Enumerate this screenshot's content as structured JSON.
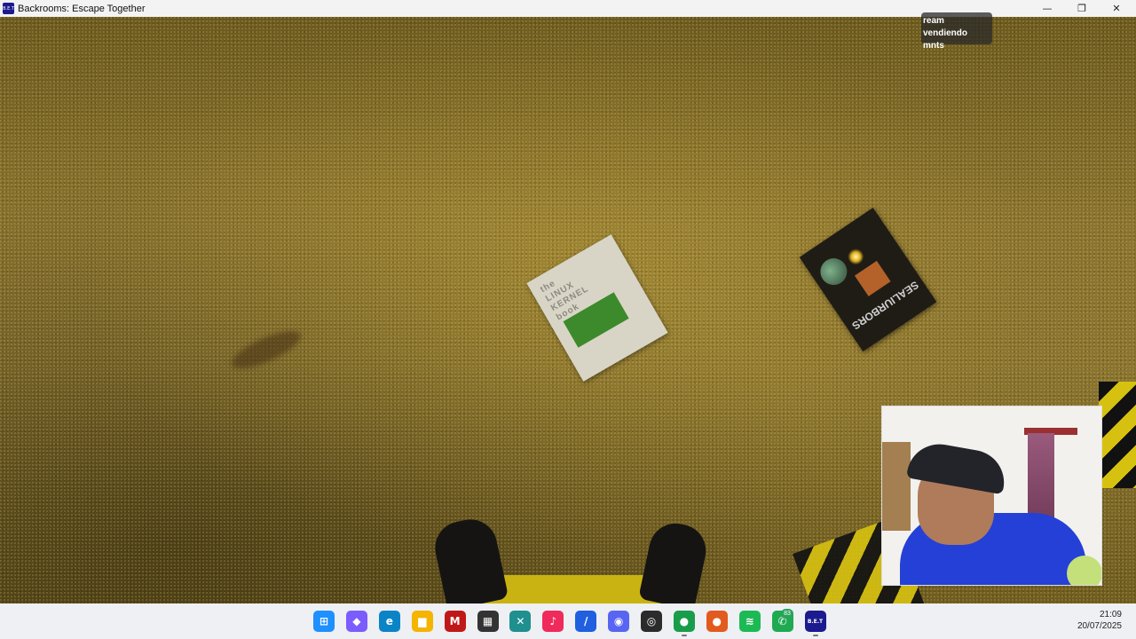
{
  "window": {
    "title": "Backrooms: Escape Together",
    "app_icon_text": "B.E.T",
    "minimize_glyph": "—",
    "maximize_glyph": "❐",
    "close_glyph": "✕"
  },
  "overlay": {
    "line1": "ream vendiendo",
    "line2": "mnts"
  },
  "scene": {
    "book1_title": "the\nLINUX\nKERNEL\nbook",
    "book2_title": "SEALIURBORS"
  },
  "taskbar": {
    "whatsapp_badge": "83",
    "time": "21:09",
    "date": "20/07/2025",
    "icons": [
      {
        "name": "start-icon",
        "glyph": "⊞",
        "color": "#1e90ff"
      },
      {
        "name": "copilot-icon",
        "glyph": "◆",
        "color": "#7b5cff"
      },
      {
        "name": "edge-icon",
        "glyph": "e",
        "color": "#0a84c6"
      },
      {
        "name": "file-explorer-icon",
        "glyph": "▆",
        "color": "#f4b400"
      },
      {
        "name": "mcafee-icon",
        "glyph": "M",
        "color": "#c01818"
      },
      {
        "name": "store-icon",
        "glyph": "▦",
        "color": "#333"
      },
      {
        "name": "capcut-icon",
        "glyph": "✕",
        "color": "#1f8f8f"
      },
      {
        "name": "tiktok-icon",
        "glyph": "♪",
        "color": "#f02a5a"
      },
      {
        "name": "editor-icon",
        "glyph": "/",
        "color": "#1f5fe0"
      },
      {
        "name": "discord-icon",
        "glyph": "◉",
        "color": "#5865f2"
      },
      {
        "name": "obs-icon",
        "glyph": "◎",
        "color": "#2b2b2b"
      },
      {
        "name": "chrome-icon",
        "glyph": "●",
        "color": "#1a9d4a"
      },
      {
        "name": "chrome-profile-icon",
        "glyph": "●",
        "color": "#e25a1e"
      },
      {
        "name": "spotify-icon",
        "glyph": "≋",
        "color": "#1db954"
      },
      {
        "name": "whatsapp-icon",
        "glyph": "✆",
        "color": "#1faa52"
      },
      {
        "name": "bet-game-icon",
        "glyph": "B.E.T",
        "color": "#1b1b8f"
      }
    ]
  }
}
